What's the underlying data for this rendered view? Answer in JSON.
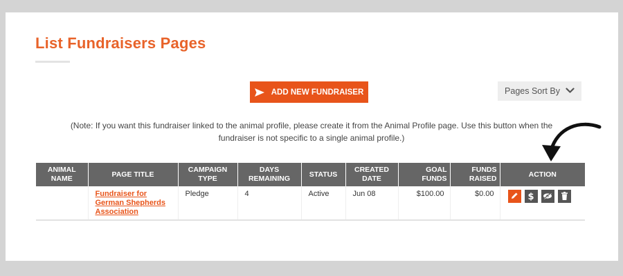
{
  "page": {
    "title": "List Fundraisers Pages"
  },
  "toolbar": {
    "add_label": "ADD NEW FUNDRAISER",
    "add_icon": "send-arrow-icon",
    "sort_label": "Pages Sort By",
    "sort_icon": "chevron-down-icon"
  },
  "note": "(Note: If you want this fundraiser linked to the animal profile, please create it from the Animal Profile page. Use this button when the fundraiser is not specific to a single animal profile.)",
  "table": {
    "headers": {
      "animal_name": "ANIMAL NAME",
      "page_title": "PAGE TITLE",
      "campaign_type": "CAMPAIGN TYPE",
      "days_remaining": "DAYS REMAINING",
      "status": "STATUS",
      "created_date": "CREATED DATE",
      "goal_funds": "GOAL FUNDS",
      "funds_raised": "FUNDS RAISED",
      "action": "ACTION"
    },
    "rows": [
      {
        "animal_name": "",
        "page_title": "Fundraiser for German Shepherds Association",
        "campaign_type": "Pledge",
        "days_remaining": "4",
        "status": "Active",
        "created_date": "Jun 08",
        "goal_funds": "$100.00",
        "funds_raised": "$0.00",
        "actions": {
          "edit_icon": "pencil-icon",
          "donate_icon": "dollar-icon",
          "visibility_icon": "eye-slash-icon",
          "delete_icon": "trash-icon"
        }
      }
    ]
  },
  "colors": {
    "brand_orange": "#e8541a",
    "title_orange": "#e8632a",
    "header_gray": "#666666",
    "action_dark": "#555555",
    "background": "#d4d4d4"
  }
}
